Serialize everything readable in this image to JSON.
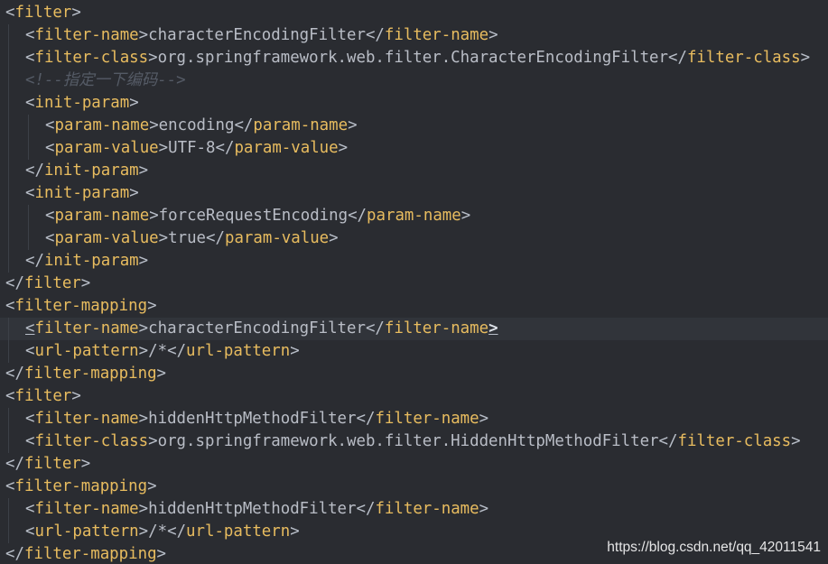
{
  "editor": {
    "language": "xml",
    "current_line": 15,
    "colors": {
      "background": "#2a2c31",
      "tag": "#e8bc5f",
      "bracket": "#b8bec8",
      "text": "#b9bdc6",
      "comment": "#555b66",
      "current_line_background": "#31343a"
    },
    "lines": [
      {
        "indent": 0,
        "parts": [
          {
            "t": "<",
            "c": "lt"
          },
          {
            "t": "filter",
            "c": "tg"
          },
          {
            "t": ">",
            "c": "lt"
          }
        ]
      },
      {
        "indent": 1,
        "parts": [
          {
            "t": "<",
            "c": "lt"
          },
          {
            "t": "filter-name",
            "c": "tg"
          },
          {
            "t": ">",
            "c": "lt"
          },
          {
            "t": "characterEncodingFilter",
            "c": "tx"
          },
          {
            "t": "</",
            "c": "lt"
          },
          {
            "t": "filter-name",
            "c": "tg"
          },
          {
            "t": ">",
            "c": "lt"
          }
        ]
      },
      {
        "indent": 1,
        "parts": [
          {
            "t": "<",
            "c": "lt"
          },
          {
            "t": "filter-class",
            "c": "tg"
          },
          {
            "t": ">",
            "c": "lt"
          },
          {
            "t": "org.springframework.web.filter.CharacterEncodingFilter",
            "c": "tx"
          },
          {
            "t": "</",
            "c": "lt"
          },
          {
            "t": "filter-class",
            "c": "tg"
          },
          {
            "t": ">",
            "c": "lt"
          }
        ]
      },
      {
        "indent": 1,
        "parts": [
          {
            "t": "<!--指定一下编码-->",
            "c": "cm"
          }
        ]
      },
      {
        "indent": 1,
        "parts": [
          {
            "t": "<",
            "c": "lt"
          },
          {
            "t": "init-param",
            "c": "tg"
          },
          {
            "t": ">",
            "c": "lt"
          }
        ]
      },
      {
        "indent": 2,
        "parts": [
          {
            "t": "<",
            "c": "lt"
          },
          {
            "t": "param-name",
            "c": "tg"
          },
          {
            "t": ">",
            "c": "lt"
          },
          {
            "t": "encoding",
            "c": "tx"
          },
          {
            "t": "</",
            "c": "lt"
          },
          {
            "t": "param-name",
            "c": "tg"
          },
          {
            "t": ">",
            "c": "lt"
          }
        ]
      },
      {
        "indent": 2,
        "parts": [
          {
            "t": "<",
            "c": "lt"
          },
          {
            "t": "param-value",
            "c": "tg"
          },
          {
            "t": ">",
            "c": "lt"
          },
          {
            "t": "UTF-8",
            "c": "tx"
          },
          {
            "t": "</",
            "c": "lt"
          },
          {
            "t": "param-value",
            "c": "tg"
          },
          {
            "t": ">",
            "c": "lt"
          }
        ]
      },
      {
        "indent": 1,
        "parts": [
          {
            "t": "</",
            "c": "lt"
          },
          {
            "t": "init-param",
            "c": "tg"
          },
          {
            "t": ">",
            "c": "lt"
          }
        ]
      },
      {
        "indent": 1,
        "parts": [
          {
            "t": "<",
            "c": "lt"
          },
          {
            "t": "init-param",
            "c": "tg"
          },
          {
            "t": ">",
            "c": "lt"
          }
        ]
      },
      {
        "indent": 2,
        "parts": [
          {
            "t": "<",
            "c": "lt"
          },
          {
            "t": "param-name",
            "c": "tg"
          },
          {
            "t": ">",
            "c": "lt"
          },
          {
            "t": "forceRequestEncoding",
            "c": "tx"
          },
          {
            "t": "</",
            "c": "lt"
          },
          {
            "t": "param-name",
            "c": "tg"
          },
          {
            "t": ">",
            "c": "lt"
          }
        ]
      },
      {
        "indent": 2,
        "parts": [
          {
            "t": "<",
            "c": "lt"
          },
          {
            "t": "param-value",
            "c": "tg"
          },
          {
            "t": ">",
            "c": "lt"
          },
          {
            "t": "true",
            "c": "tx"
          },
          {
            "t": "</",
            "c": "lt"
          },
          {
            "t": "param-value",
            "c": "tg"
          },
          {
            "t": ">",
            "c": "lt"
          }
        ]
      },
      {
        "indent": 1,
        "parts": [
          {
            "t": "</",
            "c": "lt"
          },
          {
            "t": "init-param",
            "c": "tg"
          },
          {
            "t": ">",
            "c": "lt"
          }
        ]
      },
      {
        "indent": 0,
        "parts": [
          {
            "t": "</",
            "c": "lt"
          },
          {
            "t": "filter",
            "c": "tg"
          },
          {
            "t": ">",
            "c": "lt"
          }
        ]
      },
      {
        "indent": 0,
        "parts": [
          {
            "t": "<",
            "c": "lt"
          },
          {
            "t": "filter-mapping",
            "c": "tg"
          },
          {
            "t": ">",
            "c": "lt"
          }
        ]
      },
      {
        "indent": 1,
        "parts": [
          {
            "t": "<",
            "c": "lt hl"
          },
          {
            "t": "filter-name",
            "c": "tg"
          },
          {
            "t": ">",
            "c": "lt"
          },
          {
            "t": "characterEncodingFilter",
            "c": "tx"
          },
          {
            "t": "</",
            "c": "lt"
          },
          {
            "t": "filter-name",
            "c": "tg"
          },
          {
            "t": ">",
            "c": "lt hl hlb"
          }
        ]
      },
      {
        "indent": 1,
        "parts": [
          {
            "t": "<",
            "c": "lt"
          },
          {
            "t": "url-pattern",
            "c": "tg"
          },
          {
            "t": ">",
            "c": "lt"
          },
          {
            "t": "/*",
            "c": "tx"
          },
          {
            "t": "</",
            "c": "lt"
          },
          {
            "t": "url-pattern",
            "c": "tg"
          },
          {
            "t": ">",
            "c": "lt"
          }
        ]
      },
      {
        "indent": 0,
        "parts": [
          {
            "t": "</",
            "c": "lt"
          },
          {
            "t": "filter-mapping",
            "c": "tg"
          },
          {
            "t": ">",
            "c": "lt"
          }
        ]
      },
      {
        "indent": 0,
        "parts": [
          {
            "t": "<",
            "c": "lt"
          },
          {
            "t": "filter",
            "c": "tg"
          },
          {
            "t": ">",
            "c": "lt"
          }
        ]
      },
      {
        "indent": 1,
        "parts": [
          {
            "t": "<",
            "c": "lt"
          },
          {
            "t": "filter-name",
            "c": "tg"
          },
          {
            "t": ">",
            "c": "lt"
          },
          {
            "t": "hiddenHttpMethodFilter",
            "c": "tx"
          },
          {
            "t": "</",
            "c": "lt"
          },
          {
            "t": "filter-name",
            "c": "tg"
          },
          {
            "t": ">",
            "c": "lt"
          }
        ]
      },
      {
        "indent": 1,
        "parts": [
          {
            "t": "<",
            "c": "lt"
          },
          {
            "t": "filter-class",
            "c": "tg"
          },
          {
            "t": ">",
            "c": "lt"
          },
          {
            "t": "org.springframework.web.filter.HiddenHttpMethodFilter",
            "c": "tx"
          },
          {
            "t": "</",
            "c": "lt"
          },
          {
            "t": "filter-class",
            "c": "tg"
          },
          {
            "t": ">",
            "c": "lt"
          }
        ]
      },
      {
        "indent": 0,
        "parts": [
          {
            "t": "</",
            "c": "lt"
          },
          {
            "t": "filter",
            "c": "tg"
          },
          {
            "t": ">",
            "c": "lt"
          }
        ]
      },
      {
        "indent": 0,
        "parts": [
          {
            "t": "<",
            "c": "lt"
          },
          {
            "t": "filter-mapping",
            "c": "tg"
          },
          {
            "t": ">",
            "c": "lt"
          }
        ]
      },
      {
        "indent": 1,
        "parts": [
          {
            "t": "<",
            "c": "lt"
          },
          {
            "t": "filter-name",
            "c": "tg"
          },
          {
            "t": ">",
            "c": "lt"
          },
          {
            "t": "hiddenHttpMethodFilter",
            "c": "tx"
          },
          {
            "t": "</",
            "c": "lt"
          },
          {
            "t": "filter-name",
            "c": "tg"
          },
          {
            "t": ">",
            "c": "lt"
          }
        ]
      },
      {
        "indent": 1,
        "parts": [
          {
            "t": "<",
            "c": "lt"
          },
          {
            "t": "url-pattern",
            "c": "tg"
          },
          {
            "t": ">",
            "c": "lt"
          },
          {
            "t": "/*",
            "c": "tx"
          },
          {
            "t": "</",
            "c": "lt"
          },
          {
            "t": "url-pattern",
            "c": "tg"
          },
          {
            "t": ">",
            "c": "lt"
          }
        ]
      },
      {
        "indent": 0,
        "parts": [
          {
            "t": "</",
            "c": "lt"
          },
          {
            "t": "filter-mapping",
            "c": "tg"
          },
          {
            "t": ">",
            "c": "lt"
          }
        ]
      }
    ]
  },
  "watermark": {
    "text": "https://blog.csdn.net/qq_42011541"
  }
}
